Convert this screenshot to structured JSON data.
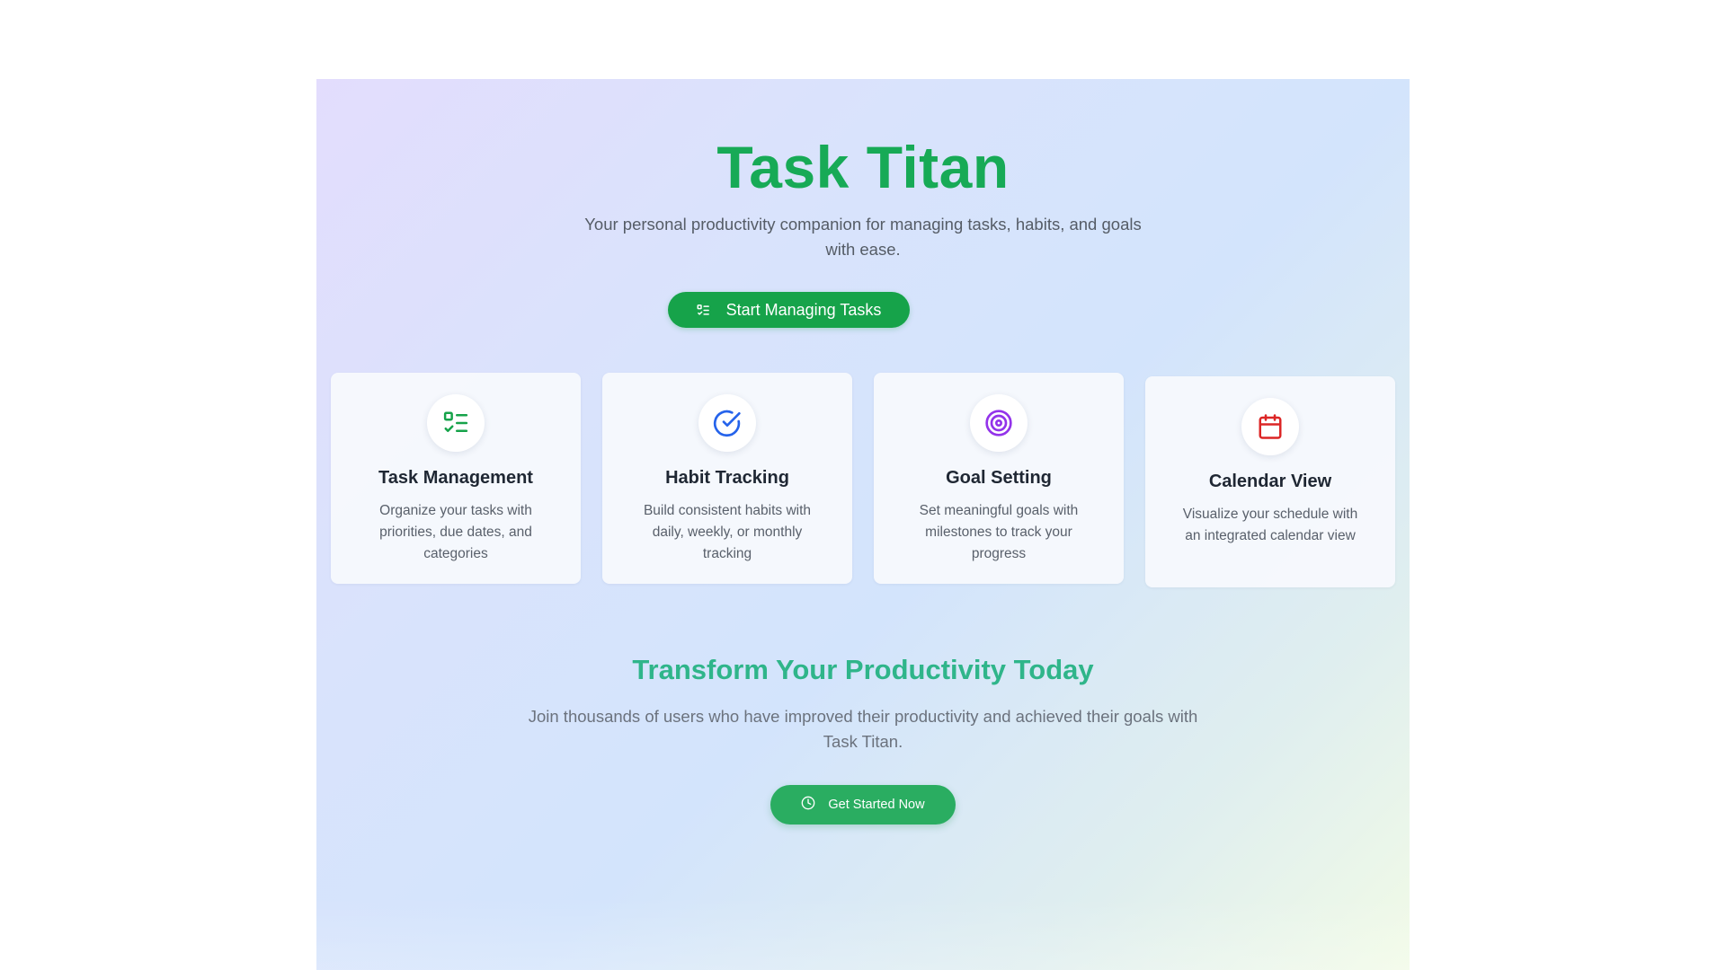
{
  "hero": {
    "title": "Task Titan",
    "subtitle": "Your personal productivity companion for managing tasks, habits, and goals with ease.",
    "primary_button": {
      "label": "Start Managing Tasks",
      "icon": "list-check-icon"
    }
  },
  "features": [
    {
      "title": "Task Management",
      "description": "Organize your tasks with priorities, due dates, and categories",
      "icon": "list-check-icon",
      "icon_color": "#16a34a"
    },
    {
      "title": "Habit Tracking",
      "description": "Build consistent habits with daily, weekly, or monthly tracking",
      "icon": "circle-check-icon",
      "icon_color": "#2563eb"
    },
    {
      "title": "Goal Setting",
      "description": "Set meaningful goals with milestones to track your progress",
      "icon": "target-icon",
      "icon_color": "#9333ea"
    },
    {
      "title": "Calendar View",
      "description": "Visualize your schedule with an integrated calendar view",
      "icon": "calendar-icon",
      "icon_color": "#dc2626"
    }
  ],
  "cta": {
    "title": "Transform Your Productivity Today",
    "subtitle": "Join thousands of users who have improved their productivity and achieved their goals with Task Titan.",
    "button": {
      "label": "Get Started Now",
      "icon": "clock-icon"
    }
  },
  "colors": {
    "brand_green": "#17aa56",
    "button_green": "#16a34a",
    "cta_title": "#2fb58a",
    "cta_button": "#2aad61"
  }
}
